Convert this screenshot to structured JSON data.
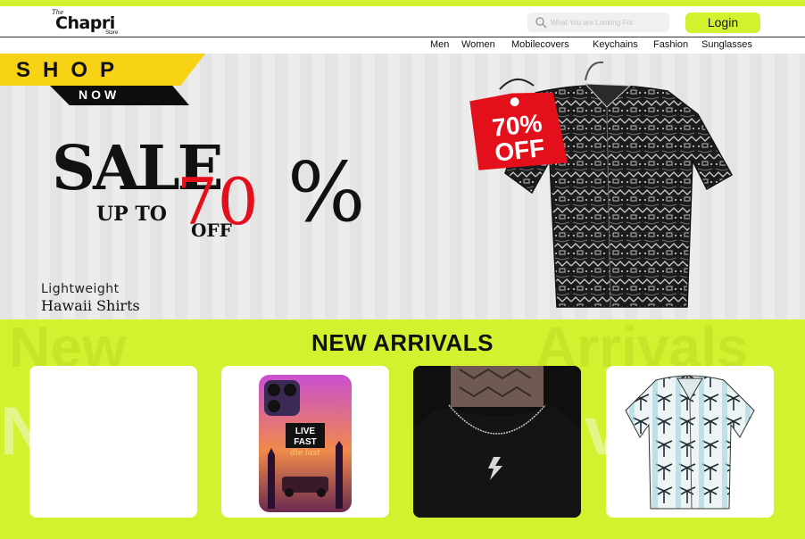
{
  "header": {
    "logo_the": "The",
    "logo_brand": "Chapri",
    "logo_store": "Store",
    "search_placeholder": "What You are Looking For",
    "login_label": "Login"
  },
  "nav": [
    "Men",
    "Women",
    "Mobilecovers",
    "Keychains",
    "Fashion",
    "Sunglasses"
  ],
  "hero": {
    "shop": "SHOP",
    "now": "NOW",
    "sale": "SALE",
    "upto": "UP TO",
    "seventy": "70",
    "percent": "%",
    "off": "OFF",
    "tag_line1": "70%",
    "tag_line2": "OFF",
    "subtitle1": "Lightweight",
    "subtitle2": "Hawaii Shirts"
  },
  "arrivals": {
    "title": "NEW ARRIVALS",
    "bg_word1": "New",
    "bg_word2": "Arrivals",
    "phone_line1": "LIVE",
    "phone_line2": "FAST",
    "phone_line3": "die last"
  },
  "colors": {
    "accent": "#d4f12f",
    "sale_red": "#e3101c",
    "banner_yellow": "#f8d315"
  }
}
